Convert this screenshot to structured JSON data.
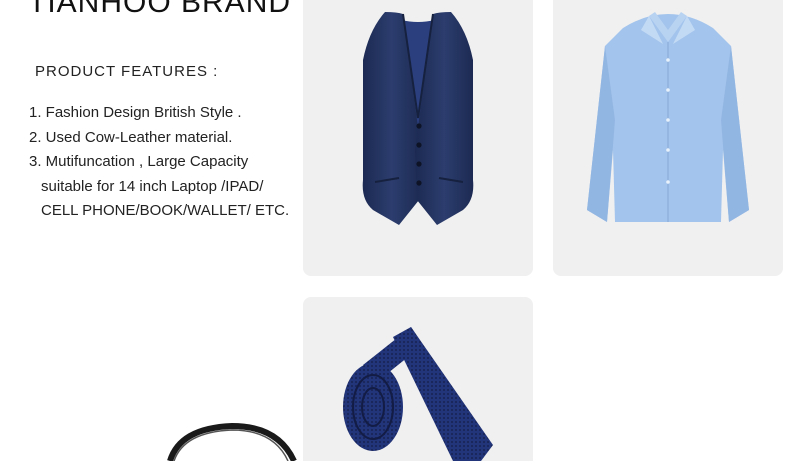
{
  "brand": {
    "title": "TIANHOO BRAND"
  },
  "features": {
    "heading": "PRODUCT  FEATURES  :",
    "lines": [
      "1. Fashion  Design British Style .",
      "2. Used Cow-Leather  material.",
      "3. Mutifuncation , Large Capacity",
      "suitable for 14 inch Laptop /IPAD/",
      "CELL PHONE/BOOK/WALLET/ ETC."
    ]
  },
  "products": [
    {
      "name": "vest",
      "color": "#24345e"
    },
    {
      "name": "dress-shirt",
      "color": "#9cc0ea"
    },
    {
      "name": "necktie",
      "color": "#1f2e6e"
    },
    {
      "name": "bag-strap",
      "color": "#1a1a1a"
    }
  ],
  "colors": {
    "card_background": "#f0f0f0",
    "page_background": "#ffffff"
  }
}
